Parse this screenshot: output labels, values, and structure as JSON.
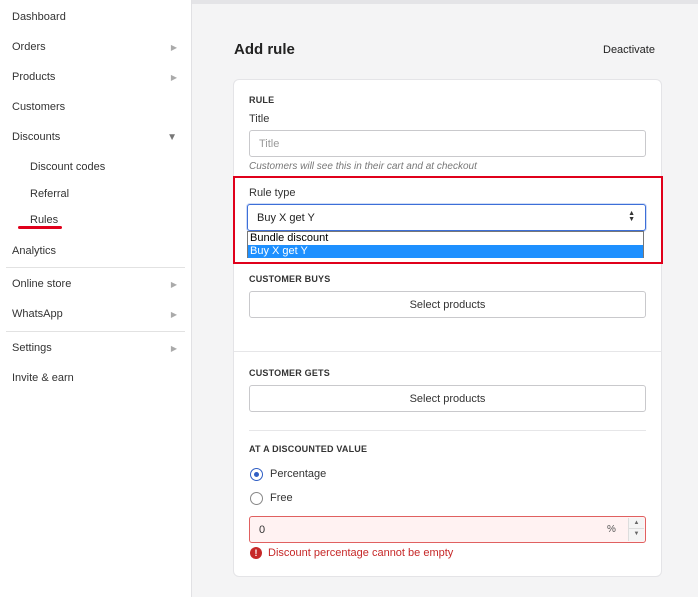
{
  "sidebar": {
    "items": [
      {
        "label": "Dashboard"
      },
      {
        "label": "Orders",
        "arrow": "▶"
      },
      {
        "label": "Products",
        "arrow": "▶"
      },
      {
        "label": "Customers"
      },
      {
        "label": "Discounts",
        "arrow": "▼"
      },
      {
        "label": "Discount codes"
      },
      {
        "label": "Referral"
      },
      {
        "label": "Rules"
      },
      {
        "label": "Analytics"
      },
      {
        "label": "Online store",
        "arrow": "▶"
      },
      {
        "label": "WhatsApp",
        "arrow": "▶"
      },
      {
        "label": "Settings",
        "arrow": "▶"
      },
      {
        "label": "Invite & earn"
      }
    ]
  },
  "header": {
    "title": "Add rule",
    "deactivate_label": "Deactivate"
  },
  "rule": {
    "section_title": "RULE",
    "title_label": "Title",
    "title_placeholder": "Title",
    "title_help": "Customers will see this in their cart and at checkout",
    "rule_type_label": "Rule type",
    "rule_type_value": "Buy X get Y",
    "rule_type_options": [
      "Bundle discount",
      "Buy X get Y"
    ]
  },
  "customer_buys": {
    "section_title": "CUSTOMER BUYS",
    "button_label": "Select products"
  },
  "customer_gets": {
    "section_title": "CUSTOMER GETS",
    "button_label": "Select products"
  },
  "discounted_value": {
    "section_title": "AT A DISCOUNTED VALUE",
    "options": [
      "Percentage",
      "Free"
    ],
    "selected": "Percentage",
    "percentage_value": "0",
    "unit": "%",
    "error_message": "Discount percentage cannot be empty"
  },
  "colors": {
    "accent": "#2f5ec4",
    "annotation_red": "#e0001b",
    "error": "#c62828",
    "dropdown_highlight": "#1e90ff"
  }
}
